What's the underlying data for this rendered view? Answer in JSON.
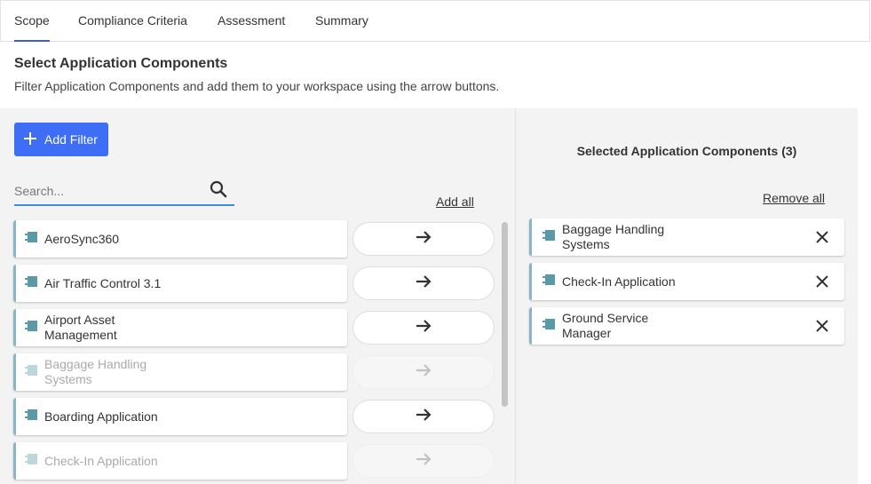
{
  "tabs": [
    {
      "label": "Scope",
      "active": true
    },
    {
      "label": "Compliance Criteria",
      "active": false
    },
    {
      "label": "Assessment",
      "active": false
    },
    {
      "label": "Summary",
      "active": false
    }
  ],
  "header": {
    "title": "Select Application Components",
    "subtitle": "Filter Application Components and add them to your workspace using the arrow buttons."
  },
  "left": {
    "add_filter_label": "Add Filter",
    "search_placeholder": "Search...",
    "add_all_label": "Add all",
    "items": [
      {
        "label": "AeroSync360",
        "disabled": false
      },
      {
        "label": "Air Traffic Control 3.1",
        "disabled": false
      },
      {
        "label": "Airport Asset Management",
        "disabled": false
      },
      {
        "label": "Baggage Handling Systems",
        "disabled": true
      },
      {
        "label": "Boarding Application",
        "disabled": false
      },
      {
        "label": "Check-In Application",
        "disabled": true
      }
    ]
  },
  "right": {
    "title": "Selected Application Components (3)",
    "remove_all_label": "Remove all",
    "items": [
      {
        "label": "Baggage Handling Systems"
      },
      {
        "label": "Check-In Application"
      },
      {
        "label": "Ground Service Manager"
      }
    ]
  },
  "colors": {
    "accent": "#3d6ef5",
    "tab_underline": "#3b5bdb",
    "card_border": "#8ab4c8",
    "component_icon": "#5a9aa8"
  },
  "icons": {
    "add_filter": "plus-icon",
    "search": "search-icon",
    "arrow": "arrow-right-icon",
    "component": "component-icon",
    "remove": "close-icon"
  }
}
